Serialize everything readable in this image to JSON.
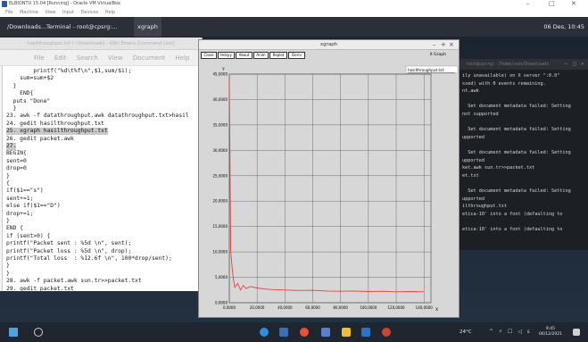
{
  "host_window": {
    "title": "ELBIONTU 15.04 [Running] - Oracle VM VirtualBox",
    "menu": [
      "File",
      "Machine",
      "View",
      "Input",
      "Devices",
      "Help"
    ],
    "controls": [
      "–",
      "□",
      "✕"
    ]
  },
  "guest_panel": {
    "tasks": [
      "/Downloads...",
      "Terminal - root@cpsrg:...",
      "xgraph"
    ],
    "status": "06 Des, 10:45"
  },
  "gedit": {
    "title": "hasilthroughput.txt (~/Downloads) - GNU Emacs [Command Line]",
    "menu": [
      "File",
      "Edit",
      "Search",
      "View",
      "Document",
      "Help"
    ],
    "lines": [
      "        printf(\"%d\\t%f\\n\",$1,sum/$1);",
      "    sum=sum+$2",
      "  }",
      "    END{",
      "  puts \"Done\"",
      "  }",
      "23. awk -f datathroughput.awk datathroughput.txt>hasil",
      "24. gedit hasilthroughput.txt",
      "25. xgraph hasilthroughput.txt",
      "26. gedit packet.awk",
      "27.",
      "BEGIN{",
      "sent=0",
      "drop=0",
      "}",
      "{",
      "if($1==\"s\")",
      "sent+=1;",
      "else if($1==\"D\")",
      "drop+=1;",
      "}",
      "END {",
      "if (sent>0) {",
      "printf(\"Packet sent : %5d \\n\", sent);",
      "printf(\"Packet loss : %5d \\n\", drop);",
      "printf(\"Total loss  : %12.6f \\n\", 100*drop/sent);",
      "}",
      "}",
      "28. awk -f packet.awk sun.tr>>packet.txt",
      "29. gedit packet.txt"
    ]
  },
  "xgraph": {
    "title": "xgraph",
    "window_controls": [
      "–",
      "+",
      "×"
    ],
    "buttons": [
      "Close",
      "Hdcpy",
      "About",
      "Anim",
      "Replot",
      "Deriv"
    ],
    "app_name": "X Graph",
    "y_label": "Y",
    "x_label": "X",
    "legend": "hasilthroughput.txt",
    "series_color": "#e8413b"
  },
  "chart_data": {
    "type": "line",
    "x": [
      0,
      1000,
      2000,
      3000,
      4000,
      6000,
      8000,
      10000,
      12000,
      15000,
      20000,
      25000,
      30000,
      40000,
      50000,
      60000,
      70000,
      80000,
      90000,
      100000,
      110000,
      120000,
      130000,
      140000
    ],
    "series": [
      {
        "name": "hasilthroughput.txt",
        "values": [
          44000,
          10000,
          7000,
          4500,
          3000,
          3800,
          2500,
          3400,
          2800,
          3200,
          2900,
          2700,
          2600,
          2500,
          2400,
          2450,
          2300,
          2250,
          2300,
          2200,
          2250,
          2150,
          2200,
          2150
        ]
      }
    ],
    "x_ticks": [
      "0.0000",
      "20,0000",
      "40,0000",
      "60,0000",
      "80,0000",
      "100,0000",
      "120,0000",
      "140,0000"
    ],
    "y_ticks": [
      "0,0000",
      "5,0000",
      "10,0000",
      "15,0000",
      "20,0000",
      "25,0000",
      "30,0000",
      "35,0000",
      "40,0000",
      "45,0000"
    ],
    "xlim": [
      0,
      145000
    ],
    "ylim": [
      0,
      45000
    ],
    "grid": true
  },
  "terminal": {
    "title": "root@cpsrg: /home/sun/Downloads",
    "controls": [
      "–",
      "□",
      "✕"
    ],
    "lines": [
      "ily unavailable) on X server \":0.0\"",
      "ssed) with 0 events remaining.",
      "nt.awk",
      "",
      "  Set document metadata failed: Setting",
      "not supported",
      "",
      "  Set document metadata failed: Setting",
      "upported",
      "",
      "  Set document metadata failed: Setting",
      "upported",
      "ket.awk sun.tr>>packet.txt",
      "et.txt",
      "",
      "  Set document metadata failed: Setting",
      "upported",
      "ilthroughput.txt",
      "etica-10' into a font (defaulting to",
      "",
      "etica-10' into a font (defaulting to"
    ]
  },
  "taskbar": {
    "weather": "24°C",
    "time": "9:45",
    "date": "06/12/2021",
    "tray": "^ ⚡ ☐ ◁ ε"
  }
}
